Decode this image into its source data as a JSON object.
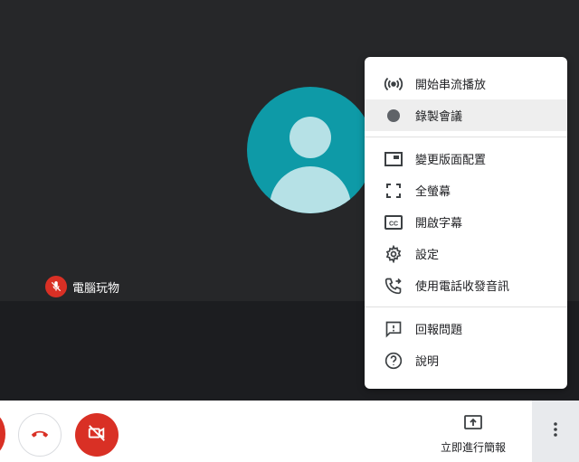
{
  "participant": {
    "name": "電腦玩物",
    "avatar_bg": "#0e9aa7",
    "mic_status": "muted"
  },
  "menu": {
    "groups": [
      [
        {
          "label": "開始串流播放",
          "icon": "broadcast-icon"
        },
        {
          "label": "錄製會議",
          "icon": "record-icon",
          "highlighted": true
        }
      ],
      [
        {
          "label": "變更版面配置",
          "icon": "layout-icon"
        },
        {
          "label": "全螢幕",
          "icon": "fullscreen-icon"
        },
        {
          "label": "開啟字幕",
          "icon": "captions-icon"
        },
        {
          "label": "設定",
          "icon": "gear-icon"
        },
        {
          "label": "使用電話收發音訊",
          "icon": "phone-forward-icon"
        }
      ],
      [
        {
          "label": "回報問題",
          "icon": "feedback-icon"
        },
        {
          "label": "說明",
          "icon": "help-icon"
        }
      ]
    ]
  },
  "toolbar": {
    "present_label": "立即進行簡報"
  },
  "colors": {
    "danger": "#d93025",
    "stage_bg": "#262729",
    "menu_highlight": "#eeeeee"
  }
}
